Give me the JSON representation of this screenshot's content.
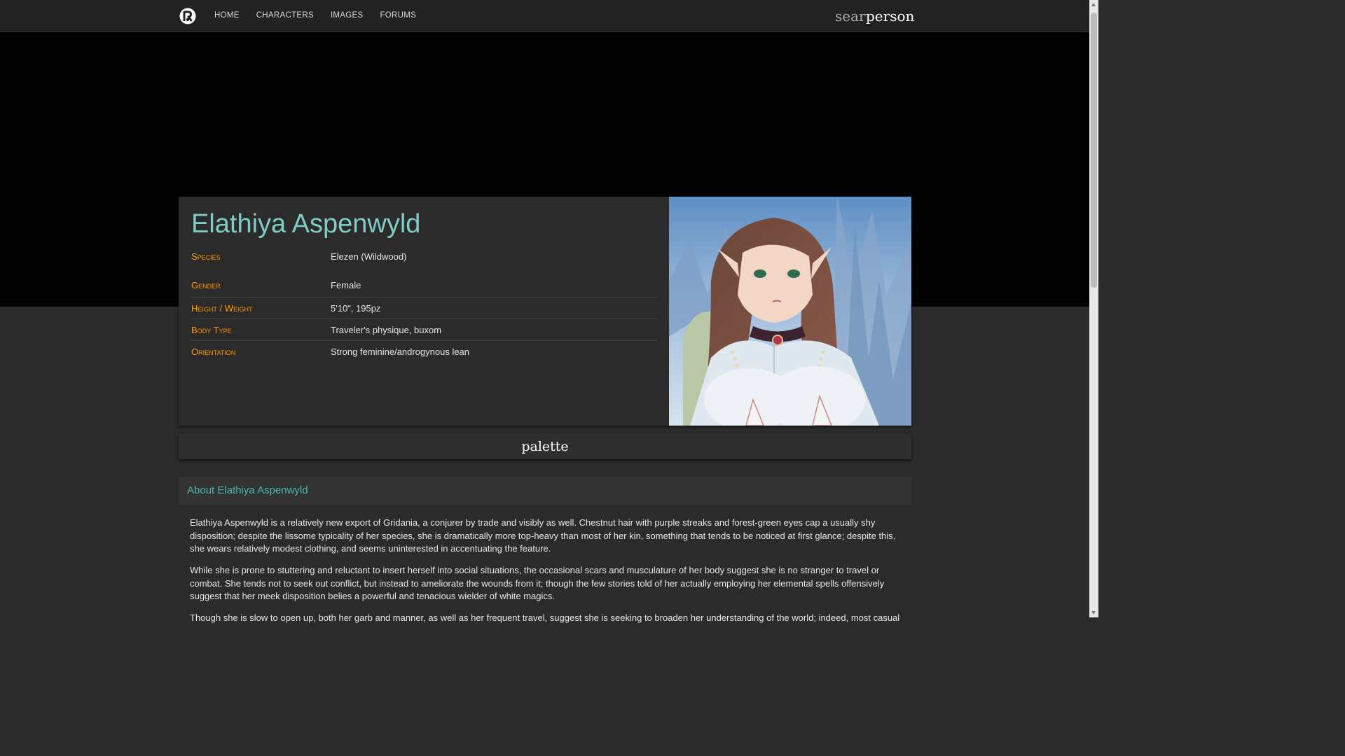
{
  "nav": {
    "links": [
      "HOME",
      "CHARACTERS",
      "IMAGES",
      "FORUMS"
    ],
    "right_icons": {
      "search": {
        "icon": "search-icon",
        "glyph": "search"
      },
      "account": {
        "icon": "person-icon",
        "glyph": "person"
      }
    }
  },
  "character": {
    "name": "Elathiya Aspenwyld",
    "fields": [
      {
        "label": "Species",
        "value": "Elezen (Wildwood)"
      },
      {
        "label": "Gender",
        "value": "Female"
      },
      {
        "label": "Height / Weight",
        "value": "5'10\", 195pz"
      },
      {
        "label": "Body Type",
        "value": "Traveler's physique, buxom"
      },
      {
        "label": "Orientation",
        "value": "Strong feminine/androgynous lean"
      }
    ]
  },
  "palette": {
    "icon": "palette-icon",
    "glyph": "palette"
  },
  "about": {
    "title": "About Elathiya Aspenwyld",
    "paragraphs": [
      "Elathiya Aspenwyld is a relatively new export of Gridania, a conjurer by trade and visibly as well. Chestnut hair with purple streaks and forest-green eyes cap a usually shy disposition; despite the lissome typicality of her species, she is dramatically more top-heavy than most of her kin, something that tends to be noticed at first glance; despite this, she wears relatively modest clothing, and seems uninterested in accentuating the feature.",
      "While she is prone to stuttering and reluctant to insert herself into social situations, the occasional scars and musculature of her body suggest she is no stranger to travel or combat. She tends not to seek out conflict, but instead to ameliorate the wounds from it; though the few stories told of her actually employing her elemental spells offensively suggest that her meek disposition belies a powerful and tenacious wielder of white magics.",
      "Though she is slow to open up, both her garb and manner, as well as her frequent travel, suggest she is seeking to broaden her understanding of the world; indeed, most casual"
    ]
  },
  "colors": {
    "name": "#80cbc4",
    "field_label": "#ff9800",
    "about_title": "#4db6ac",
    "page_bg": "#2b2b2b",
    "nav_bg": "#222222"
  }
}
